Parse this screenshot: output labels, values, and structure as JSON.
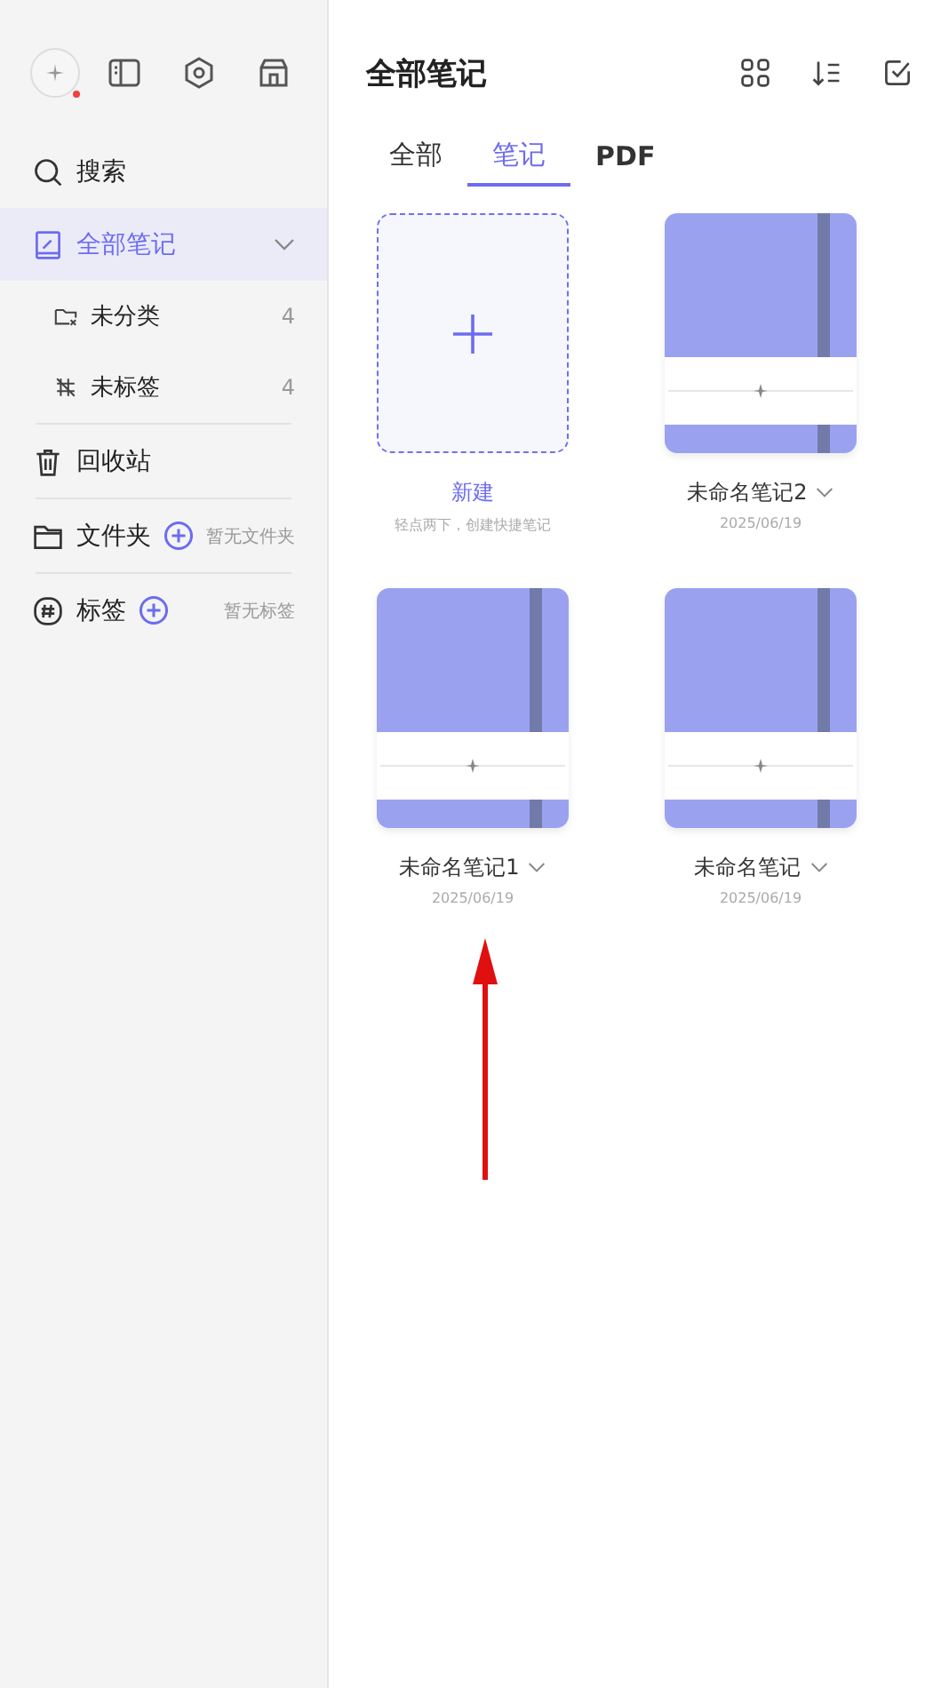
{
  "sidebar": {
    "has_notification": true,
    "search": {
      "label": "搜索"
    },
    "items": [
      {
        "kind": "section",
        "label": "全部笔记",
        "selected": true,
        "expanded": true,
        "children": [
          {
            "label": "未分类",
            "count": "4"
          },
          {
            "label": "未标签",
            "count": "4"
          }
        ]
      },
      {
        "kind": "plain",
        "label": "回收站",
        "selected": false
      },
      {
        "kind": "addable",
        "label": "文件夹",
        "selected": false,
        "hint": "暂无文件夹"
      },
      {
        "kind": "addable",
        "label": "标签",
        "selected": false,
        "hint": "暂无标签"
      }
    ]
  },
  "main": {
    "title": "全部笔记",
    "tabs": [
      {
        "label": "全部",
        "selected": false
      },
      {
        "label": "笔记",
        "selected": true
      },
      {
        "label": "PDF",
        "selected": false
      }
    ],
    "notes": [
      {
        "kind": "new",
        "title": "新建",
        "subtitle": "轻点两下，创建快捷笔记"
      },
      {
        "kind": "notebook",
        "title": "未命名笔记2",
        "date": "2025/06/19"
      },
      {
        "kind": "notebook",
        "title": "未命名笔记1",
        "date": "2025/06/19"
      },
      {
        "kind": "notebook",
        "title": "未命名笔记",
        "date": "2025/06/19"
      }
    ]
  }
}
